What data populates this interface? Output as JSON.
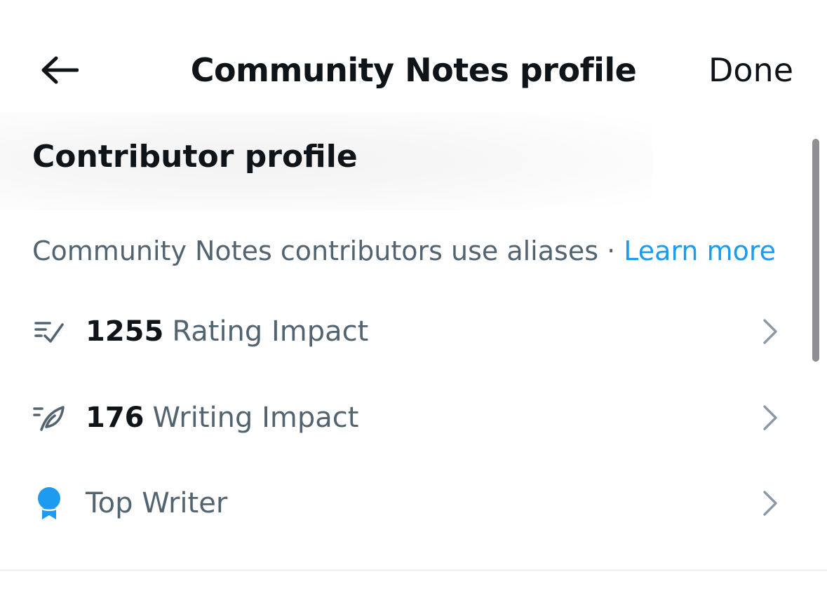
{
  "header": {
    "title": "Community Notes profile",
    "done_label": "Done"
  },
  "section": {
    "title": "Contributor profile",
    "description": "Community Notes contributors use aliases",
    "separator": "·",
    "learn_more": "Learn more"
  },
  "rows": [
    {
      "icon": "rating-impact-icon",
      "value": "1255",
      "label": "Rating Impact"
    },
    {
      "icon": "writing-impact-icon",
      "value": "176",
      "label": "Writing Impact"
    },
    {
      "icon": "top-writer-badge-icon",
      "value": "",
      "label": "Top Writer"
    }
  ],
  "colors": {
    "text_primary": "#0f1419",
    "text_secondary": "#536471",
    "link": "#1d9bf0",
    "badge": "#1d9bf0",
    "chevron": "#8b98a5"
  }
}
